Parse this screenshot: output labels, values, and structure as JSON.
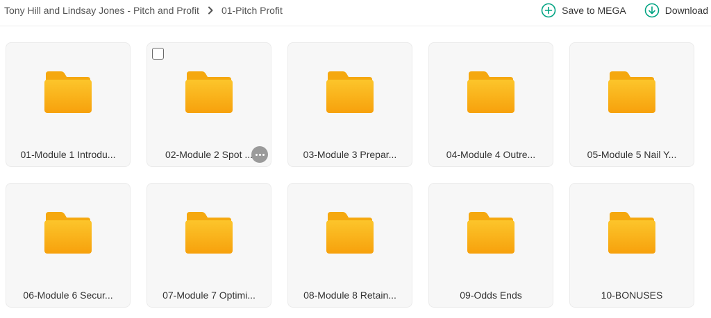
{
  "breadcrumb": {
    "items": [
      "Tony Hill and Lindsay Jones - Pitch and Profit",
      "01-Pitch Profit"
    ],
    "separator_icon": "chevron-right-icon"
  },
  "actions": {
    "save_label": "Save to MEGA",
    "save_icon": "plus-circle-icon",
    "download_label": "Download",
    "download_icon": "download-circle-icon",
    "accent_color": "#00a382"
  },
  "folders": [
    {
      "label": "01-Module 1 Introdu..."
    },
    {
      "label": "02-Module 2 Spot ...",
      "checkbox_visible": true,
      "more_menu_visible": true
    },
    {
      "label": "03-Module 3 Prepar..."
    },
    {
      "label": "04-Module 4 Outre..."
    },
    {
      "label": "05-Module 5 Nail Y..."
    },
    {
      "label": "06-Module 6 Secur..."
    },
    {
      "label": "07-Module 7 Optimi..."
    },
    {
      "label": "08-Module 8 Retain..."
    },
    {
      "label": "09-Odds Ends"
    },
    {
      "label": "10-BONUSES"
    }
  ],
  "folder_icon": "folder-icon",
  "folder_color": "#f9a411"
}
